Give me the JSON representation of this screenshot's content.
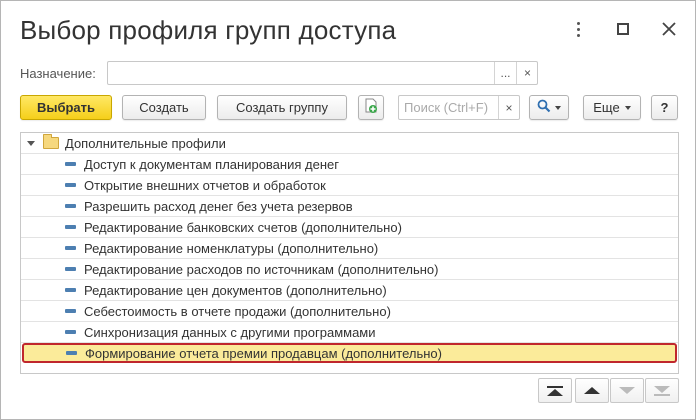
{
  "window": {
    "title": "Выбор профиля групп доступа",
    "more_icon": "vertical-dots-icon",
    "maximize_icon": "maximize-icon",
    "close_icon": "close-icon",
    "close_glyph": "✕"
  },
  "purpose_field": {
    "label": "Назначение:",
    "value": "",
    "select_glyph": "...",
    "clear_glyph": "×"
  },
  "toolbar": {
    "select_label": "Выбрать",
    "create_label": "Создать",
    "create_group_label": "Создать группу",
    "copy_icon": "copy-document-icon",
    "search_placeholder": "Поиск (Ctrl+F)",
    "search_clear_glyph": "×",
    "find_icon": "magnifier-icon",
    "more_label": "Еще",
    "help_label": "?",
    "accent_color": "#f5cf1a"
  },
  "list": {
    "group": {
      "label": "Дополнительные профили",
      "icon": "folder-icon",
      "expanded": true
    },
    "items": [
      {
        "label": "Доступ к документам планирования денег"
      },
      {
        "label": "Открытие внешних отчетов и обработок"
      },
      {
        "label": "Разрешить расход денег без учета резервов"
      },
      {
        "label": "Редактирование банковских счетов (дополнительно)"
      },
      {
        "label": "Редактирование номенклатуры (дополнительно)"
      },
      {
        "label": "Редактирование расходов по источникам (дополнительно)"
      },
      {
        "label": "Редактирование цен документов (дополнительно)"
      },
      {
        "label": "Себестоимость в отчете продажи (дополнительно)"
      },
      {
        "label": "Синхронизация данных с другими программами"
      },
      {
        "label": "Формирование отчета премии продавцам (дополнительно)",
        "selected": true
      }
    ],
    "selected_highlight_color": "#fbeb9a",
    "selected_border_color": "#c0272d"
  },
  "navigation": {
    "first_icon": "move-to-top-icon",
    "up_icon": "move-up-icon",
    "down_icon": "move-down-icon",
    "last_icon": "move-to-bottom-icon"
  }
}
